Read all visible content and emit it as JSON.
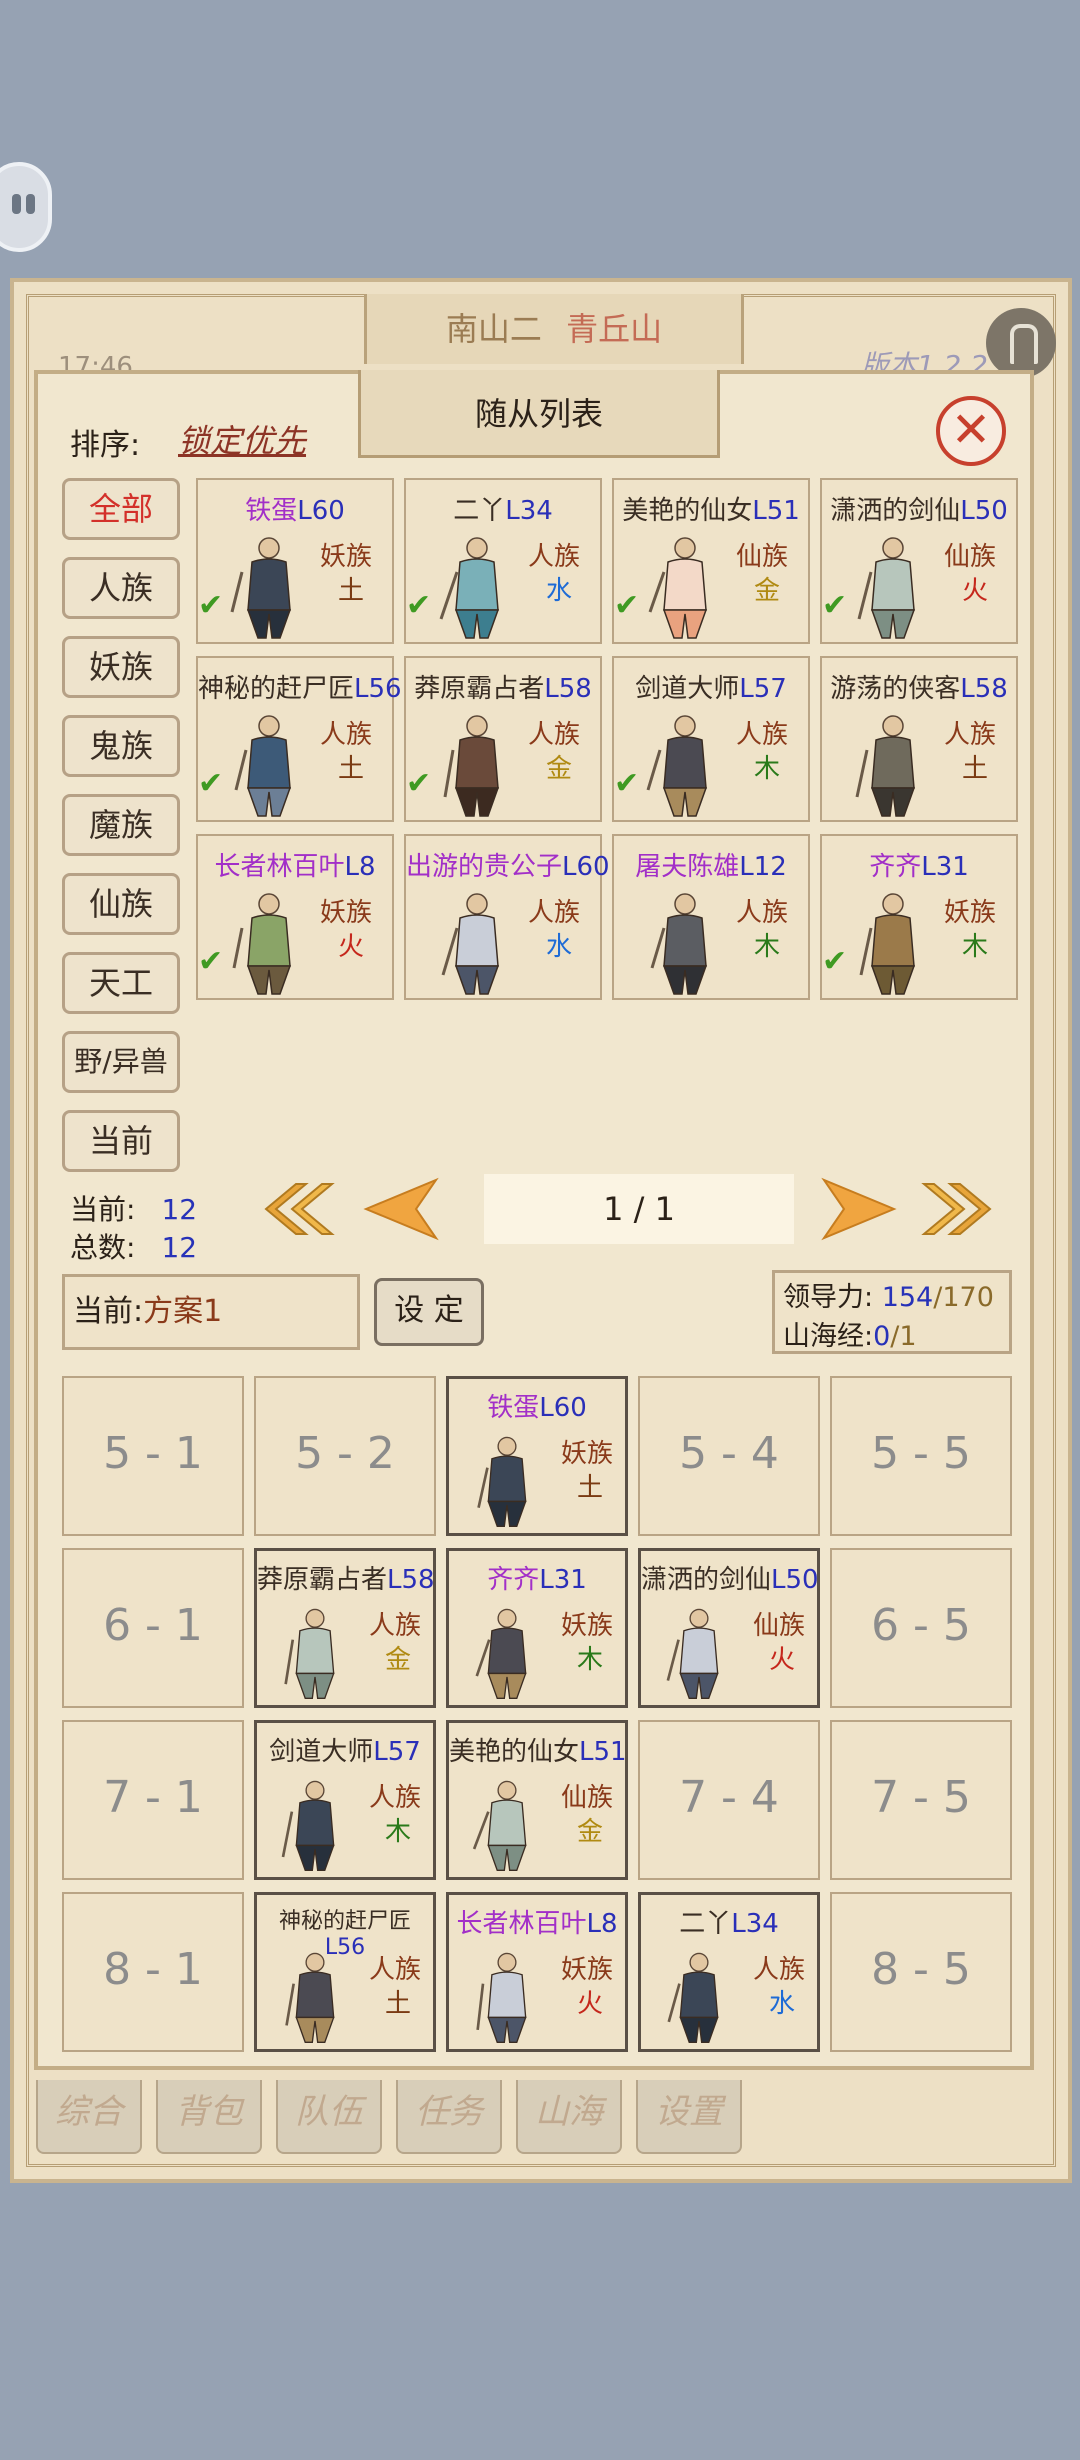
{
  "background": {
    "map_title": "南山二",
    "map_subtitle": "青丘山",
    "time": "17:46",
    "version": "版本1.2.2"
  },
  "dialog": {
    "title": "随从列表",
    "sort_label": "排序:",
    "sort_value": "锁定优先",
    "close_label": "✕"
  },
  "categories": [
    "全部",
    "人族",
    "妖族",
    "鬼族",
    "魔族",
    "仙族",
    "天工",
    "野/异兽",
    "当前"
  ],
  "followers": [
    {
      "name": "铁蛋",
      "level": "L60",
      "race": "妖族",
      "element": "土",
      "name_color": "purple",
      "checked": true
    },
    {
      "name": "二丫",
      "level": "L34",
      "race": "人族",
      "element": "水",
      "name_color": "dark",
      "checked": true
    },
    {
      "name": "美艳的仙女",
      "level": "L51",
      "race": "仙族",
      "element": "金",
      "name_color": "dark",
      "checked": true
    },
    {
      "name": "潇洒的剑仙",
      "level": "L50",
      "race": "仙族",
      "element": "火",
      "name_color": "dark",
      "checked": true
    },
    {
      "name": "神秘的赶尸匠",
      "level": "L56",
      "race": "人族",
      "element": "土",
      "name_color": "dark",
      "checked": true
    },
    {
      "name": "莽原霸占者",
      "level": "L58",
      "race": "人族",
      "element": "金",
      "name_color": "dark",
      "checked": true
    },
    {
      "name": "剑道大师",
      "level": "L57",
      "race": "人族",
      "element": "木",
      "name_color": "dark",
      "checked": true
    },
    {
      "name": "游荡的侠客",
      "level": "L58",
      "race": "人族",
      "element": "土",
      "name_color": "dark",
      "checked": false
    },
    {
      "name": "长者林百叶",
      "level": "L8",
      "race": "妖族",
      "element": "火",
      "name_color": "purple",
      "checked": true
    },
    {
      "name": "出游的贵公子",
      "level": "L60",
      "race": "人族",
      "element": "水",
      "name_color": "purple",
      "checked": false
    },
    {
      "name": "屠夫陈雄",
      "level": "L12",
      "race": "人族",
      "element": "木",
      "name_color": "purple",
      "checked": false
    },
    {
      "name": "齐齐",
      "level": "L31",
      "race": "妖族",
      "element": "木",
      "name_color": "purple",
      "checked": true
    }
  ],
  "counts": {
    "current_label": "当前:",
    "current_value": "12",
    "total_label": "总数:",
    "total_value": "12"
  },
  "pager": {
    "indicator": "1 / 1"
  },
  "plan": {
    "label": "当前:",
    "value": "方案1",
    "set_label": "设 定"
  },
  "stats": {
    "leadership_label": "领导力:",
    "leadership_value": "154",
    "leadership_max": "/170",
    "shanhai_label": "山海经:",
    "shanhai_value": "0",
    "shanhai_max": "/1"
  },
  "formation": [
    [
      {
        "label": "5 - 1"
      },
      {
        "label": "5 - 2"
      },
      {
        "name": "铁蛋",
        "level": "L60",
        "race": "妖族",
        "element": "土",
        "name_color": "purple"
      },
      {
        "label": "5 - 4"
      },
      {
        "label": "5 - 5"
      }
    ],
    [
      {
        "label": "6 - 1"
      },
      {
        "name": "莽原霸占者",
        "level": "L58",
        "race": "人族",
        "element": "金",
        "name_color": "dark"
      },
      {
        "name": "齐齐",
        "level": "L31",
        "race": "妖族",
        "element": "木",
        "name_color": "purple"
      },
      {
        "name": "潇洒的剑仙",
        "level": "L50",
        "race": "仙族",
        "element": "火",
        "name_color": "dark"
      },
      {
        "label": "6 - 5"
      }
    ],
    [
      {
        "label": "7 - 1"
      },
      {
        "name": "剑道大师",
        "level": "L57",
        "race": "人族",
        "element": "木",
        "name_color": "dark"
      },
      {
        "name": "美艳的仙女",
        "level": "L51",
        "race": "仙族",
        "element": "金",
        "name_color": "dark"
      },
      {
        "label": "7 - 4"
      },
      {
        "label": "7 - 5"
      }
    ],
    [
      {
        "label": "8 - 1"
      },
      {
        "name": "神秘的赶尸匠",
        "level": "L56",
        "race": "人族",
        "element": "土",
        "name_color": "dark",
        "wrap": true
      },
      {
        "name": "长者林百叶",
        "level": "L8",
        "race": "妖族",
        "element": "火",
        "name_color": "purple"
      },
      {
        "name": "二丫",
        "level": "L34",
        "race": "人族",
        "element": "水",
        "name_color": "dark"
      },
      {
        "label": "8 - 5"
      }
    ]
  ],
  "bottom_tabs": [
    "综合",
    "背包",
    "队伍",
    "任务",
    "山海",
    "设置"
  ],
  "colors": {
    "background": "#96a2b3",
    "parchment": "#f1e7cf",
    "close_red": "#c7402d",
    "level_blue": "#2a2fb8",
    "name_purple": "#a22fc8",
    "check_green": "#3f9a22"
  }
}
